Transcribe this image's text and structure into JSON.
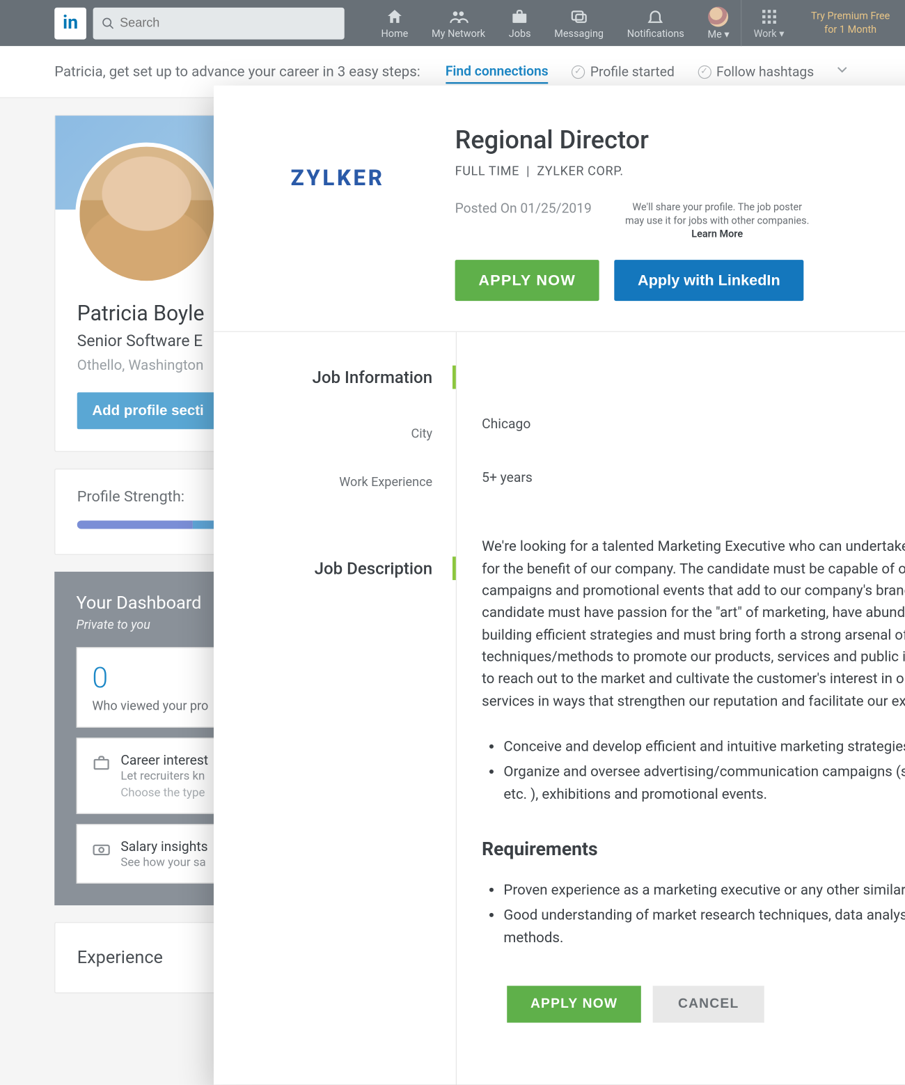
{
  "nav": {
    "logo": "in",
    "search_placeholder": "Search",
    "items": {
      "home": "Home",
      "network": "My Network",
      "jobs": "Jobs",
      "messaging": "Messaging",
      "notifications": "Notifications",
      "me": "Me",
      "work": "Work"
    },
    "premium_line1": "Try Premium Free",
    "premium_line2": "for 1 Month"
  },
  "onboarding": {
    "prompt": "Patricia, get set up to advance your career in 3 easy steps:",
    "step1": "Find connections",
    "step2": "Profile started",
    "step3": "Follow hashtags"
  },
  "profile": {
    "name": "Patricia Boyle",
    "title": "Senior Software E",
    "location": "Othello, Washington",
    "add_section_btn": "Add profile secti"
  },
  "strength": {
    "label": "Profile Strength:"
  },
  "dashboard": {
    "title": "Your Dashboard",
    "subtitle": "Private to you",
    "views_count": "0",
    "views_label": "Who viewed your pro",
    "career_title": "Career interest",
    "career_sub": "Let recruiters kn",
    "career_sub2": "Choose the type",
    "salary_title": "Salary insights",
    "salary_sub": "See how your sa"
  },
  "experience": {
    "heading": "Experience"
  },
  "modal": {
    "company_logo_text": "ZYLKER",
    "job_title": "Regional Director",
    "job_type": "FULL TIME",
    "separator": "|",
    "company": "ZYLKER CORP.",
    "posted_label": "Posted On ",
    "posted_date": "01/25/2019",
    "disclosure_line1": "We'll share your profile. The job poster",
    "disclosure_line2": "may use it for jobs with other companies.",
    "disclosure_learn": "Learn More",
    "apply_now": "APPLY  NOW",
    "apply_linkedin": "Apply with LinkedIn",
    "section_info": "Job Information",
    "label_city": "City",
    "val_city": "Chicago",
    "label_exp": "Work Experience",
    "val_exp": "5+ years",
    "section_desc": "Job Description",
    "desc_paragraph": "We're looking for a talented Marketing Executive who can undertake marketing projects for the benefit of our company. The candidate must be capable of  organize creative campaigns and promotional events that add to our company's brand value. Ideally, the  candidate must have passion for the \"art\" of marketing, have abundant ideas for building efficient strategies and must bring forth a strong arsenal of techniques/methods to promote our products, services and public image.  The goal is to reach out to the market and cultivate the customer's interest in our products and services in ways that strengthen our reputation and facilitate our exponential growth.",
    "bullet1": "Conceive and develop efficient and intuitive marketing strategies.",
    "bullet2": "Organize and oversee advertising/communication campaigns (social media, TV etc. ), exhibitions and promotional events.",
    "req_heading": "Requirements",
    "req1": "Proven experience as a marketing executive or any other similar role.",
    "req2": "Good understanding of market research techniques, data analysis and statistics methods.",
    "apply_now_btn": "APPLY  NOW",
    "cancel_btn": "CANCEL"
  }
}
